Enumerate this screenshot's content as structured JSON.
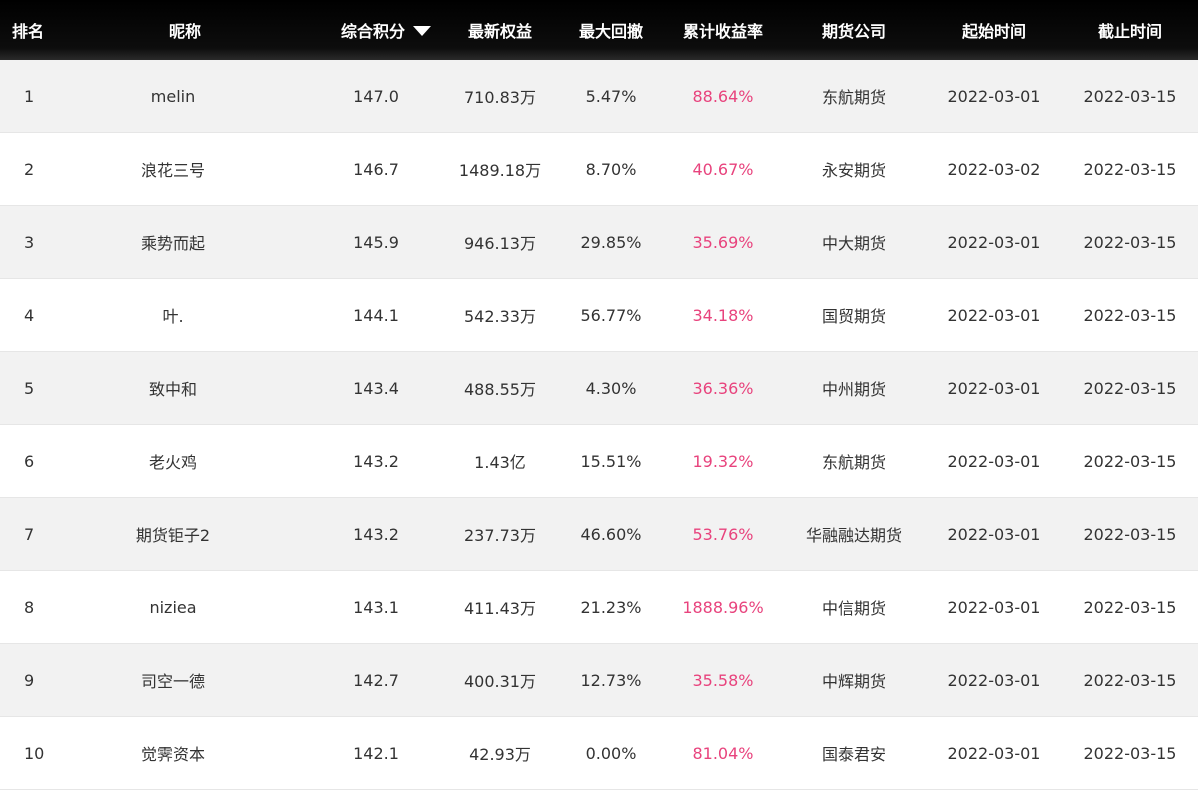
{
  "header": {
    "rank": "排名",
    "nickname": "昵称",
    "score": "综合积分",
    "equity": "最新权益",
    "drawdown": "最大回撤",
    "return": "累计收益率",
    "company": "期货公司",
    "start": "起始时间",
    "end": "截止时间",
    "sort_icon": "caret-down-icon"
  },
  "colors": {
    "header_bg": "#000000",
    "return_text": "#e8437d",
    "odd_row_bg": "#f2f2f2"
  },
  "rows": [
    {
      "rank": "1",
      "nickname": "melin",
      "score": "147.0",
      "equity": "710.83万",
      "drawdown": "5.47%",
      "return": "88.64%",
      "company": "东航期货",
      "start": "2022-03-01",
      "end": "2022-03-15"
    },
    {
      "rank": "2",
      "nickname": "浪花三号",
      "score": "146.7",
      "equity": "1489.18万",
      "drawdown": "8.70%",
      "return": "40.67%",
      "company": "永安期货",
      "start": "2022-03-02",
      "end": "2022-03-15"
    },
    {
      "rank": "3",
      "nickname": "乘势而起",
      "score": "145.9",
      "equity": "946.13万",
      "drawdown": "29.85%",
      "return": "35.69%",
      "company": "中大期货",
      "start": "2022-03-01",
      "end": "2022-03-15"
    },
    {
      "rank": "4",
      "nickname": "叶.",
      "score": "144.1",
      "equity": "542.33万",
      "drawdown": "56.77%",
      "return": "34.18%",
      "company": "国贸期货",
      "start": "2022-03-01",
      "end": "2022-03-15"
    },
    {
      "rank": "5",
      "nickname": "致中和",
      "score": "143.4",
      "equity": "488.55万",
      "drawdown": "4.30%",
      "return": "36.36%",
      "company": "中州期货",
      "start": "2022-03-01",
      "end": "2022-03-15"
    },
    {
      "rank": "6",
      "nickname": "老火鸡",
      "score": "143.2",
      "equity": "1.43亿",
      "drawdown": "15.51%",
      "return": "19.32%",
      "company": "东航期货",
      "start": "2022-03-01",
      "end": "2022-03-15"
    },
    {
      "rank": "7",
      "nickname": "期货钜子2",
      "score": "143.2",
      "equity": "237.73万",
      "drawdown": "46.60%",
      "return": "53.76%",
      "company": "华融融达期货",
      "start": "2022-03-01",
      "end": "2022-03-15"
    },
    {
      "rank": "8",
      "nickname": "niziea",
      "score": "143.1",
      "equity": "411.43万",
      "drawdown": "21.23%",
      "return": "1888.96%",
      "company": "中信期货",
      "start": "2022-03-01",
      "end": "2022-03-15"
    },
    {
      "rank": "9",
      "nickname": "司空一德",
      "score": "142.7",
      "equity": "400.31万",
      "drawdown": "12.73%",
      "return": "35.58%",
      "company": "中辉期货",
      "start": "2022-03-01",
      "end": "2022-03-15"
    },
    {
      "rank": "10",
      "nickname": "觉霁资本",
      "score": "142.1",
      "equity": "42.93万",
      "drawdown": "0.00%",
      "return": "81.04%",
      "company": "国泰君安",
      "start": "2022-03-01",
      "end": "2022-03-15"
    }
  ]
}
